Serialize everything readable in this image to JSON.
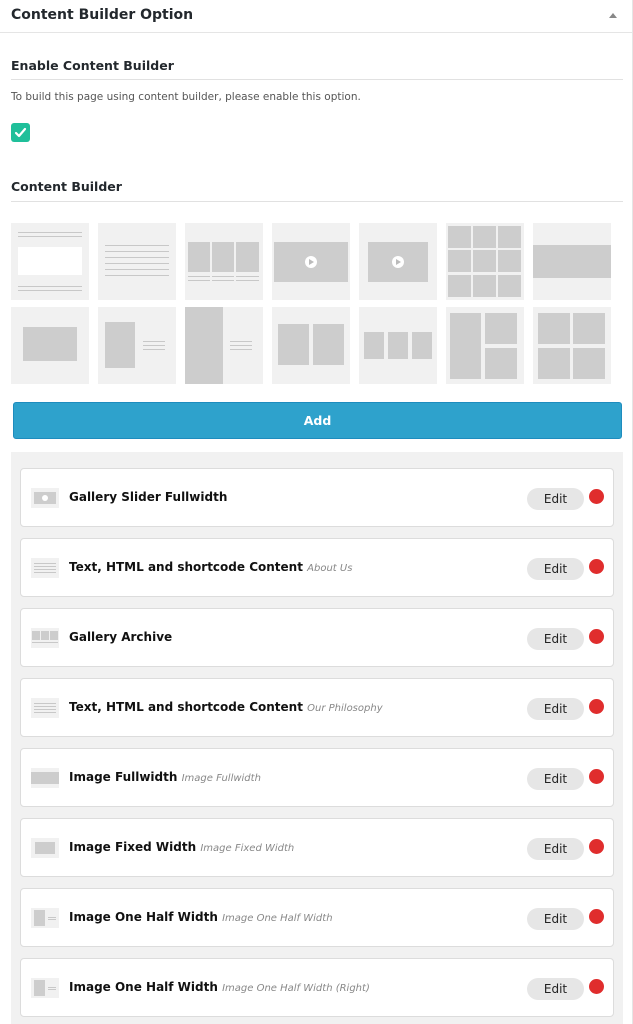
{
  "panel": {
    "title": "Content Builder Option"
  },
  "enable": {
    "title": "Enable Content Builder",
    "description": "To build this page using content builder, please enable this option.",
    "checked": true,
    "accent_color": "#1fbf9a"
  },
  "builder": {
    "title": "Content Builder",
    "templates": [
      {
        "icon": "text-content-template-icon"
      },
      {
        "icon": "text-lines-template-icon"
      },
      {
        "icon": "gallery-archive-template-icon"
      },
      {
        "icon": "gallery-slider-fullwidth-template-icon"
      },
      {
        "icon": "gallery-slider-fixed-template-icon"
      },
      {
        "icon": "gallery-grid-template-icon"
      },
      {
        "icon": "image-fullwidth-template-icon"
      },
      {
        "icon": "image-fixed-width-template-icon"
      },
      {
        "icon": "image-one-half-width-template-icon"
      },
      {
        "icon": "image-one-half-width-right-template-icon"
      },
      {
        "icon": "image-two-columns-template-icon"
      },
      {
        "icon": "image-three-columns-template-icon"
      },
      {
        "icon": "image-mixed-grid-template-icon"
      },
      {
        "icon": "image-four-grid-template-icon"
      }
    ],
    "add_label": "Add",
    "add_color": "#2ea2cc"
  },
  "items": [
    {
      "title": "Gallery Slider Fullwidth",
      "subtitle": "",
      "edit": "Edit",
      "icon": "gallery-slider-thumb-icon"
    },
    {
      "title": "Text, HTML and shortcode Content",
      "subtitle": "About Us",
      "edit": "Edit",
      "icon": "text-content-thumb-icon"
    },
    {
      "title": "Gallery Archive",
      "subtitle": "",
      "edit": "Edit",
      "icon": "gallery-archive-thumb-icon"
    },
    {
      "title": "Text, HTML and shortcode Content",
      "subtitle": "Our Philosophy",
      "edit": "Edit",
      "icon": "text-content-thumb-icon"
    },
    {
      "title": "Image Fullwidth",
      "subtitle": "Image Fullwidth",
      "edit": "Edit",
      "icon": "image-fullwidth-thumb-icon"
    },
    {
      "title": "Image Fixed Width",
      "subtitle": "Image Fixed Width",
      "edit": "Edit",
      "icon": "image-fixed-width-thumb-icon"
    },
    {
      "title": "Image One Half Width",
      "subtitle": "Image One Half Width",
      "edit": "Edit",
      "icon": "image-one-half-thumb-icon"
    },
    {
      "title": "Image One Half Width",
      "subtitle": "Image One Half Width (Right)",
      "edit": "Edit",
      "icon": "image-one-half-right-thumb-icon"
    }
  ],
  "remove_color": "#e02d2d"
}
